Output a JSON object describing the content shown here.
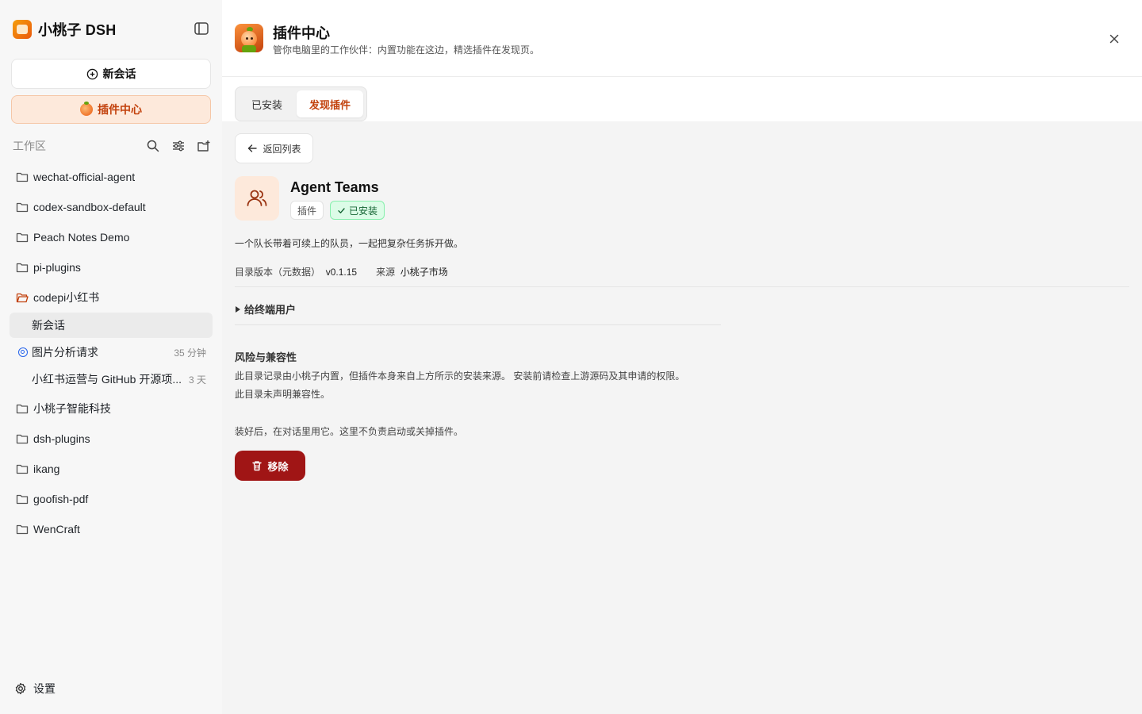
{
  "app": {
    "name": "小桃子 DSH"
  },
  "sidebar": {
    "new_chat_label": "新会话",
    "plugin_center_label": "插件中心",
    "workspace_label": "工作区",
    "workspaces": [
      {
        "name": "wechat-official-agent"
      },
      {
        "name": "codex-sandbox-default"
      },
      {
        "name": "Peach Notes Demo"
      },
      {
        "name": "pi-plugins"
      },
      {
        "name": "codepi小红书",
        "open": true
      },
      {
        "name": "小桃子智能科技"
      },
      {
        "name": "dsh-plugins"
      },
      {
        "name": "ikang"
      },
      {
        "name": "goofish-pdf"
      },
      {
        "name": "WenCraft"
      }
    ],
    "sessions": [
      {
        "title": "新会话",
        "time": "",
        "active": true
      },
      {
        "title": "图片分析请求",
        "time": "35 分钟",
        "status": "running"
      },
      {
        "title": "小红书运营与 GitHub 开源项...",
        "time": "3 天"
      }
    ],
    "settings_label": "设置"
  },
  "header": {
    "title": "插件中心",
    "subtitle": "管你电脑里的工作伙伴：内置功能在这边，精选插件在发现页。"
  },
  "tabs": [
    {
      "label": "已安装",
      "active": false
    },
    {
      "label": "发现插件",
      "active": true
    }
  ],
  "detail": {
    "back_label": "返回列表",
    "name": "Agent Teams",
    "kind_badge": "插件",
    "status_badge": "已安装",
    "description": "一个队长带着可续上的队员，一起把复杂任务拆开做。",
    "version_label": "目录版本（元数据）",
    "version": "v0.1.15",
    "source_label": "来源",
    "source": "小桃子市场",
    "details_summary": "给终端用户",
    "risk_title": "风险与兼容性",
    "risk_line1": "此目录记录由小桃子内置，但插件本身来自上方所示的安装来源。 安装前请检查上游源码及其申请的权限。",
    "risk_line2": "此目录未声明兼容性。",
    "usage_hint": "装好后，在对话里用它。这里不负责启动或关掉插件。",
    "remove_label": "移除"
  },
  "colors": {
    "accent": "#c2410c",
    "accent_bg": "#fde9db",
    "danger": "#a01515",
    "success_bg": "#dcfce7",
    "success_text": "#166534"
  }
}
